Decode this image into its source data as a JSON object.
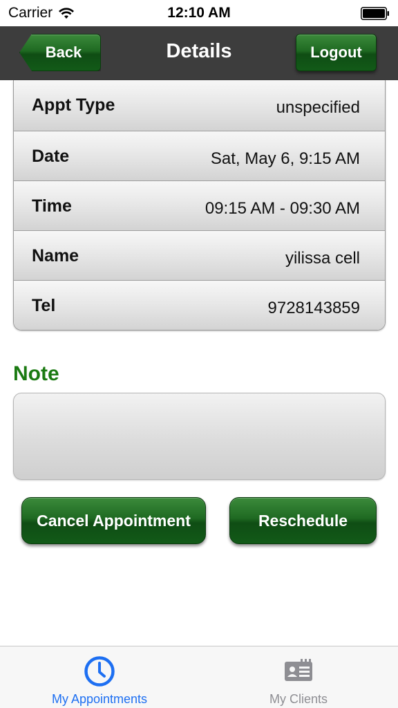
{
  "status_bar": {
    "carrier": "Carrier",
    "time": "12:10 AM",
    "icons": [
      "wifi-icon",
      "battery-icon"
    ]
  },
  "nav": {
    "title": "Details",
    "back_label": "Back",
    "logout_label": "Logout"
  },
  "details": {
    "rows": [
      {
        "label": "Appt Type",
        "value": "unspecified"
      },
      {
        "label": "Date",
        "value": "Sat, May 6, 9:15 AM"
      },
      {
        "label": "Time",
        "value": "09:15 AM - 09:30 AM"
      },
      {
        "label": "Name",
        "value": "yilissa cell"
      },
      {
        "label": "Tel",
        "value": "9728143859"
      }
    ]
  },
  "note": {
    "heading": "Note",
    "content": ""
  },
  "actions": {
    "cancel_label": "Cancel Appointment",
    "reschedule_label": "Reschedule"
  },
  "tabs": [
    {
      "label": "My Appointments",
      "icon": "clock-icon",
      "active": true
    },
    {
      "label": "My Clients",
      "icon": "id-card-icon",
      "active": false
    }
  ],
  "colors": {
    "accent_green": "#1b7a12",
    "button_green": "#1f6a22",
    "nav_bar": "#3d3d3d",
    "tab_active": "#1d6ff2",
    "tab_inactive": "#8e8e93"
  }
}
